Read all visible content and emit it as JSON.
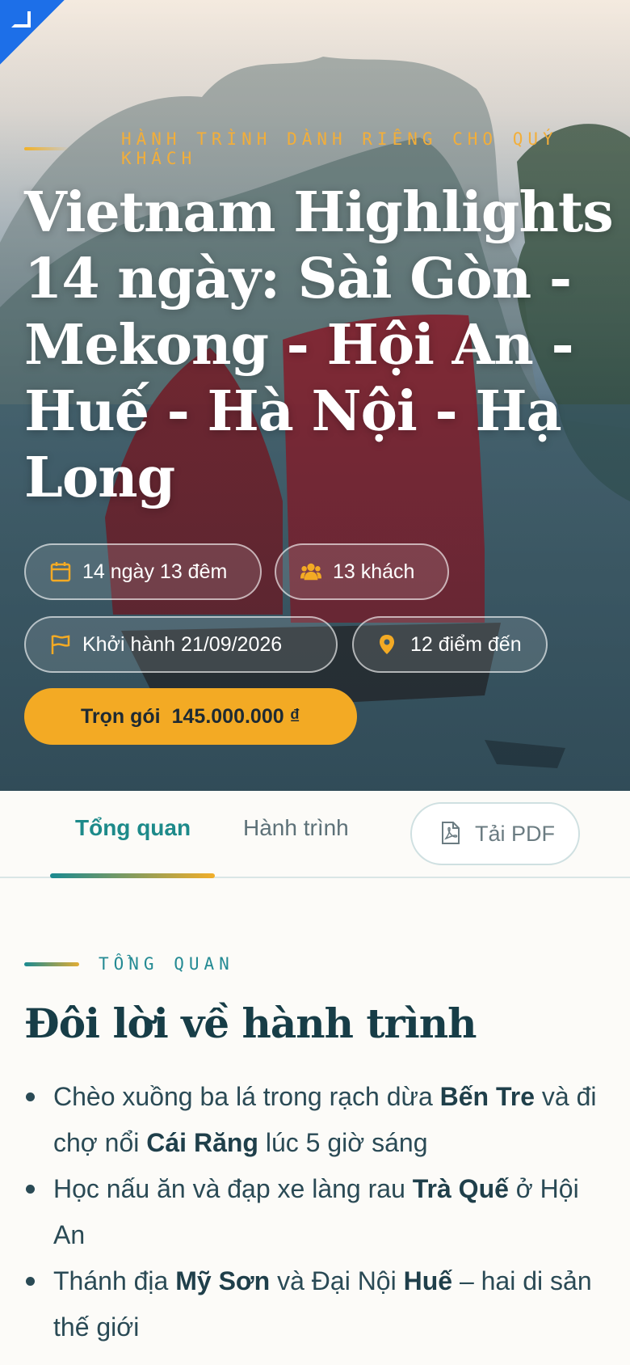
{
  "hero": {
    "eyebrow": "HÀNH TRÌNH DÀNH RIÊNG CHO QUÝ KHÁCH",
    "title": "Vietnam Highlights 14 ngày: Sài Gòn - Mekong - Hội An - Huế - Hà Nội - Hạ Long",
    "facts": {
      "duration": "14 ngày 13 đêm",
      "guests": "13 khách",
      "departure": "Khởi hành 21/09/2026",
      "destinations": "12 điểm đến"
    },
    "price": {
      "label": "Trọn gói",
      "amount": "145.000.000 ₫"
    }
  },
  "tabs": {
    "overview": "Tổng quan",
    "itinerary": "Hành trình",
    "pdf": "Tải PDF"
  },
  "overview": {
    "eyebrow": "TỔNG QUAN",
    "title": "Đôi lời về hành trình",
    "highlights": [
      {
        "t1": "Chèo xuồng ba lá trong rạch dừa ",
        "b1": "Bến Tre",
        "t2": " và đi chợ nổi ",
        "b2": "Cái Răng",
        "t3": " lúc 5 giờ sáng"
      },
      {
        "t1": "Học nấu ăn và đạp xe làng rau ",
        "b1": "Trà Quế",
        "t2": " ở Hội An"
      },
      {
        "t1": "Thánh địa ",
        "b1": "Mỹ Sơn",
        "t2": " và Đại Nội ",
        "b2": "Huế",
        "t3": " – hai di sản thế giới"
      }
    ]
  },
  "colors": {
    "accent": "#f3aa24",
    "teal": "#1d8a8a",
    "navy": "#173d47"
  },
  "icons": [
    "calendar-icon",
    "users-icon",
    "flag-icon",
    "map-pin-icon",
    "pdf-file-icon"
  ]
}
